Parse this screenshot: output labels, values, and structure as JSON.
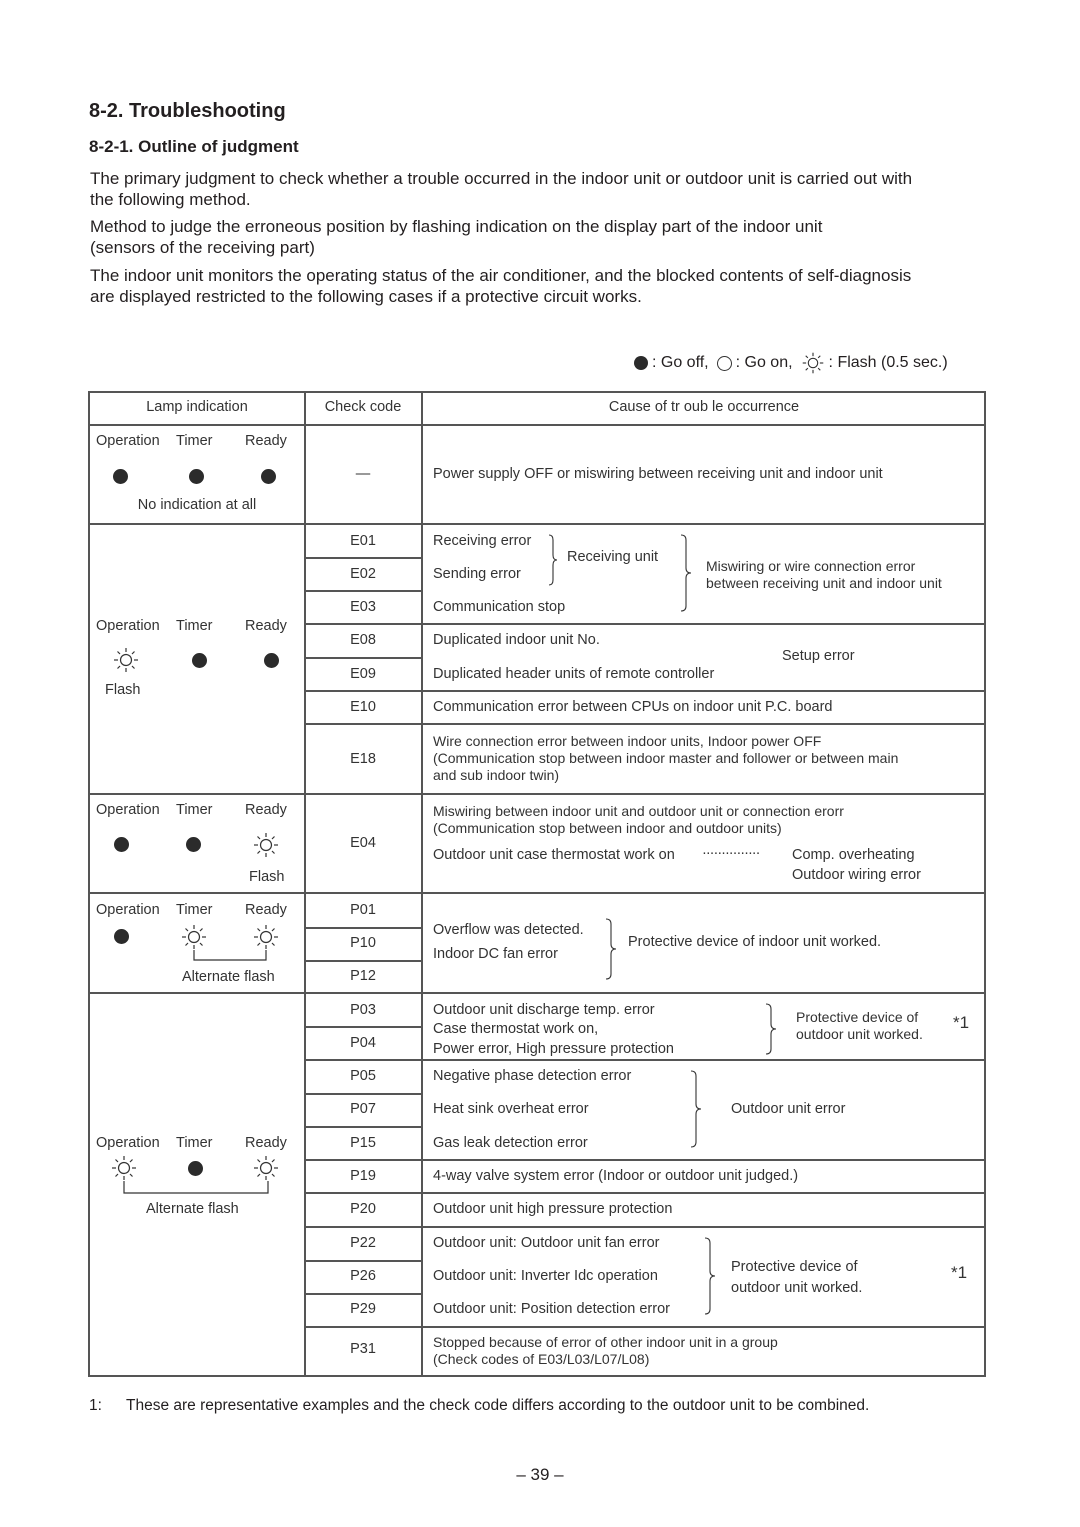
{
  "section_title": "8-2.  Troubleshooting",
  "subsection_title": "8-2-1.  Outline of judgment",
  "paragraphs": [
    "The primary judgment to check whether a trouble occurred in the indoor unit or outdoor unit is carried out with the following method.",
    "Method to judge the erroneous position by flashing indication on the display part of the indoor unit (sensors of the receiving part)",
    "The indoor unit monitors the operating status of the air conditioner, and the blocked contents of self-diagnosis are displayed restricted to the following cases if a protective circuit works."
  ],
  "paragraph_lines": {
    "p1_l1": "The primary judgment to check whether a trouble occurred in the indoor unit or outdoor unit is carried out with",
    "p1_l2": "the following method.",
    "p2_l1": "Method to judge the erroneous position by flashing indication on the display part of the indoor unit",
    "p2_l2": "(sensors of the receiving part)",
    "p3_l1": "The indoor unit monitors the operating status of the air conditioner, and the blocked contents of self-diagnosis",
    "p3_l2": "are displayed restricted to the following cases if a protective circuit works."
  },
  "legend": {
    "off_icon": "filled-circle",
    "off_label": ": Go off,",
    "on_icon": "open-circle",
    "on_label": ": Go on,",
    "flash_icon": "flash-sun",
    "flash_label": ": Flash (0.5 sec.)"
  },
  "table": {
    "headers": {
      "lamp": "Lamp indication",
      "code": "Check code",
      "cause": "Cause of tr oub le occurrence"
    },
    "lamp_names": {
      "operation": "Operation",
      "timer": "Timer",
      "ready": "Ready"
    },
    "groups": [
      {
        "lamps": {
          "operation": "off",
          "timer": "off",
          "ready": "off"
        },
        "caption": "No indication at all",
        "codes": [
          "—"
        ],
        "causes": [
          "Power supply OFF or miswiring between receiving unit and indoor unit"
        ]
      },
      {
        "lamps": {
          "operation": "flash",
          "timer": "off",
          "ready": "off"
        },
        "caption": "Flash",
        "codes": [
          "E01",
          "E02",
          "E03",
          "E08",
          "E09",
          "E10",
          "E18"
        ],
        "causes": {
          "e01": "Receiving error",
          "e02": "Sending error",
          "e03": "Communication stop",
          "receiving_unit": "Receiving unit",
          "miswiring_l1": "Miswiring or wire connection error",
          "miswiring_l2": "between receiving unit and indoor unit",
          "e08": "Duplicated indoor unit No.",
          "e09": "Duplicated header units of remote controller",
          "setup_error": "Setup error",
          "e10": "Communication error between CPUs on indoor unit P.C. board",
          "e18_l1": "Wire connection error between indoor units, Indoor power OFF",
          "e18_l2": "(Communication stop between indoor master and follower or between main",
          "e18_l3": "and sub indoor twin)"
        }
      },
      {
        "lamps": {
          "operation": "off",
          "timer": "off",
          "ready": "flash"
        },
        "caption": "Flash",
        "codes": [
          "E04"
        ],
        "causes": {
          "l1": "Miswiring between indoor unit and outdoor unit or connection erorr",
          "l2": "(Communication stop between indoor and outdoor units)",
          "l3": "Outdoor unit case thermostat work on",
          "dots": "···············",
          "comp": "Comp. overheating",
          "wiring": "Outdoor wiring error"
        }
      },
      {
        "lamps": {
          "operation": "off",
          "timer": "flash",
          "ready": "flash"
        },
        "caption": "Alternate flash",
        "codes": [
          "P01",
          "P10",
          "P12"
        ],
        "causes": {
          "overflow": "Overflow was detected.",
          "fan": "Indoor DC fan error",
          "result": "Protective device of indoor unit worked."
        }
      },
      {
        "lamps": {
          "operation": "flash",
          "timer": "off",
          "ready": "flash"
        },
        "caption": "Alternate flash",
        "codes": [
          "P03",
          "P04",
          "P05",
          "P07",
          "P15",
          "P19",
          "P20",
          "P22",
          "P26",
          "P29",
          "P31"
        ],
        "causes": {
          "p03": "Outdoor unit discharge temp. error",
          "p04_l1": "Case thermostat work on,",
          "p04_l2": "Power error, High pressure protection",
          "prot_l1": "Protective device of",
          "prot_l2": "outdoor unit worked.",
          "note": "*1",
          "p05": "Negative phase detection error",
          "p07": "Heat sink overheat error",
          "p15": "Gas leak detection error",
          "outdoor_error": "Outdoor unit error",
          "p19": "4-way valve system error (Indoor or outdoor unit judged.)",
          "p20": "Outdoor unit high pressure protection",
          "p22": "Outdoor unit: Outdoor unit fan error",
          "p26": "Outdoor unit: Inverter Idc operation",
          "p29": "Outdoor unit: Position detection error",
          "p31_l1": "Stopped because of error of other indoor unit in a group",
          "p31_l2": "(Check codes of E03/L03/L07/L08)"
        }
      }
    ]
  },
  "footnote": {
    "marker": "1:",
    "text": "These are representative examples and the check code differs according to the outdoor unit to be combined."
  },
  "page_number": "– 39 –"
}
